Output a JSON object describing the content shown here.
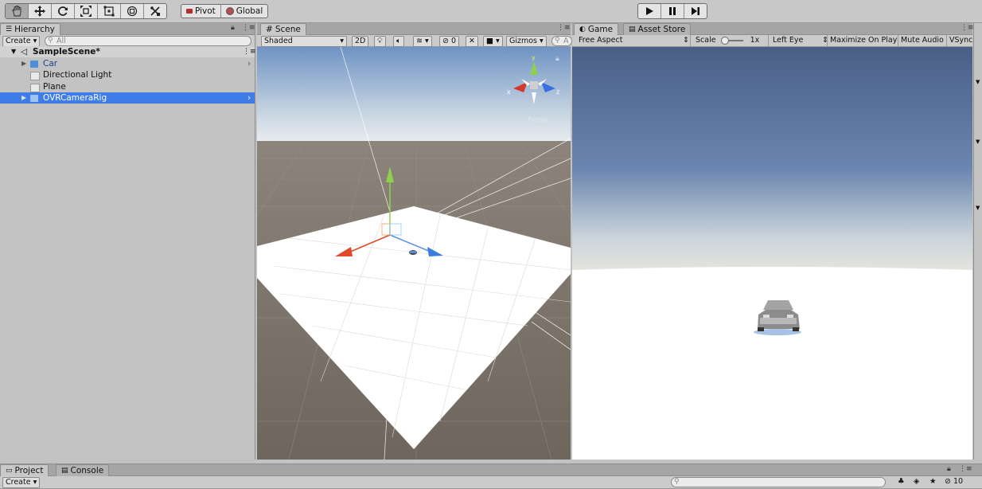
{
  "toolbar": {
    "pivot_label": "Pivot",
    "global_label": "Global"
  },
  "hierarchy": {
    "tab_label": "Hierarchy",
    "create_label": "Create",
    "search_placeholder": "All",
    "scene_name": "SampleScene*",
    "items": [
      {
        "label": "Car"
      },
      {
        "label": "Directional Light"
      },
      {
        "label": "Plane"
      },
      {
        "label": "OVRCameraRig"
      }
    ]
  },
  "scene": {
    "tab_label": "Scene",
    "shading_mode": "Shaded",
    "mode_2d": "2D",
    "hidden_count": "0",
    "gizmos_label": "Gizmos",
    "search_placeholder": "A",
    "persp_label": "Persp",
    "axis_x": "x",
    "axis_y": "y",
    "axis_z": "z"
  },
  "game": {
    "tab_label": "Game",
    "asset_store_label": "Asset Store",
    "aspect": "Free Aspect",
    "scale_label": "Scale",
    "scale_value": "1x",
    "eye": "Left Eye",
    "maximize_on_play": "Maximize On Play",
    "mute_audio": "Mute Audio",
    "vsync": "VSync"
  },
  "bottom": {
    "project_tab": "Project",
    "console_tab": "Console",
    "create_label": "Create",
    "hidden_count": "10"
  }
}
